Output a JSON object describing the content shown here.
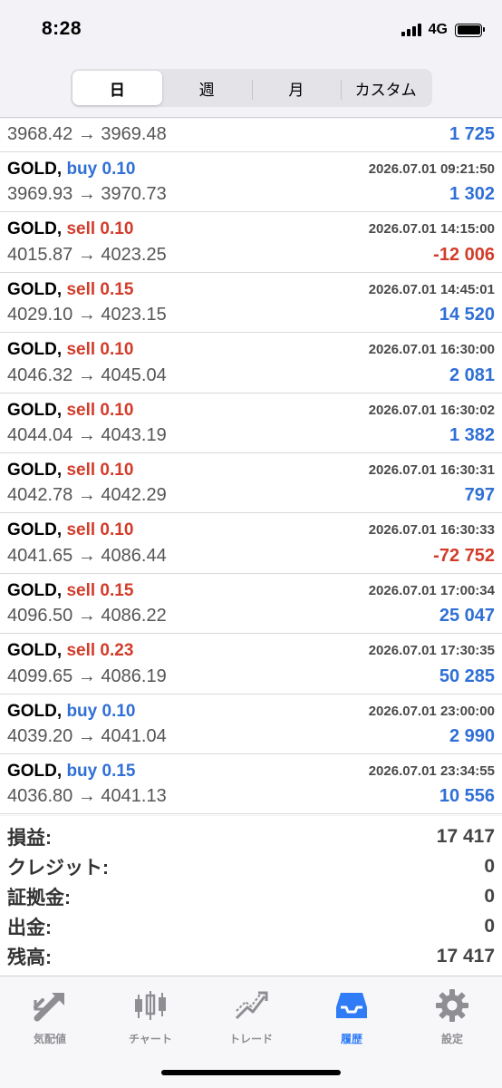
{
  "status": {
    "time": "8:28",
    "network": "4G"
  },
  "segments": [
    {
      "label": "日",
      "active": true
    },
    {
      "label": "週",
      "active": false
    },
    {
      "label": "月",
      "active": false
    },
    {
      "label": "カスタム",
      "active": false
    }
  ],
  "first_row": {
    "prices": "3968.42 → 3969.48",
    "profit": "1 725"
  },
  "trades": [
    {
      "symbol": "GOLD,",
      "side": "buy 0.10",
      "dir": "buy",
      "date": "2026.07.01 09:21:50",
      "prices": "3969.93 → 3970.73",
      "profit": "1 302",
      "sign": "pos"
    },
    {
      "symbol": "GOLD,",
      "side": "sell 0.10",
      "dir": "sell",
      "date": "2026.07.01 14:15:00",
      "prices": "4015.87 → 4023.25",
      "profit": "-12 006",
      "sign": "neg"
    },
    {
      "symbol": "GOLD,",
      "side": "sell 0.15",
      "dir": "sell",
      "date": "2026.07.01 14:45:01",
      "prices": "4029.10 → 4023.15",
      "profit": "14 520",
      "sign": "pos"
    },
    {
      "symbol": "GOLD,",
      "side": "sell 0.10",
      "dir": "sell",
      "date": "2026.07.01 16:30:00",
      "prices": "4046.32 → 4045.04",
      "profit": "2 081",
      "sign": "pos"
    },
    {
      "symbol": "GOLD,",
      "side": "sell 0.10",
      "dir": "sell",
      "date": "2026.07.01 16:30:02",
      "prices": "4044.04 → 4043.19",
      "profit": "1 382",
      "sign": "pos"
    },
    {
      "symbol": "GOLD,",
      "side": "sell 0.10",
      "dir": "sell",
      "date": "2026.07.01 16:30:31",
      "prices": "4042.78 → 4042.29",
      "profit": "797",
      "sign": "pos"
    },
    {
      "symbol": "GOLD,",
      "side": "sell 0.10",
      "dir": "sell",
      "date": "2026.07.01 16:30:33",
      "prices": "4041.65 → 4086.44",
      "profit": "-72 752",
      "sign": "neg"
    },
    {
      "symbol": "GOLD,",
      "side": "sell 0.15",
      "dir": "sell",
      "date": "2026.07.01 17:00:34",
      "prices": "4096.50 → 4086.22",
      "profit": "25 047",
      "sign": "pos"
    },
    {
      "symbol": "GOLD,",
      "side": "sell 0.23",
      "dir": "sell",
      "date": "2026.07.01 17:30:35",
      "prices": "4099.65 → 4086.19",
      "profit": "50 285",
      "sign": "pos"
    },
    {
      "symbol": "GOLD,",
      "side": "buy 0.10",
      "dir": "buy",
      "date": "2026.07.01 23:00:00",
      "prices": "4039.20 → 4041.04",
      "profit": "2 990",
      "sign": "pos"
    },
    {
      "symbol": "GOLD,",
      "side": "buy 0.15",
      "dir": "buy",
      "date": "2026.07.01 23:34:55",
      "prices": "4036.80 → 4041.13",
      "profit": "10 556",
      "sign": "pos"
    }
  ],
  "summary": [
    {
      "label": "損益:",
      "value": "17 417"
    },
    {
      "label": "クレジット:",
      "value": "0"
    },
    {
      "label": "証拠金:",
      "value": "0"
    },
    {
      "label": "出金:",
      "value": "0"
    },
    {
      "label": "残高:",
      "value": "17 417"
    }
  ],
  "tabs": [
    {
      "label": "気配値",
      "icon": "quotes-icon",
      "active": false
    },
    {
      "label": "チャート",
      "icon": "chart-icon",
      "active": false
    },
    {
      "label": "トレード",
      "icon": "trade-icon",
      "active": false
    },
    {
      "label": "履歴",
      "icon": "history-icon",
      "active": true
    },
    {
      "label": "設定",
      "icon": "settings-icon",
      "active": false
    }
  ],
  "colors": {
    "buy": "#2f6fd6",
    "sell": "#d23c2a",
    "active_tab": "#2f7cf6",
    "inactive_tab": "#8e8e93"
  }
}
